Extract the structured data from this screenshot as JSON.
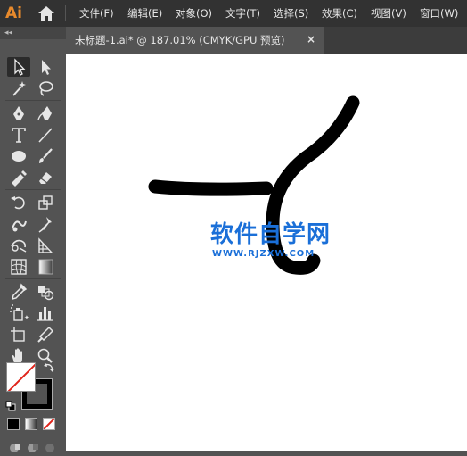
{
  "app": {
    "logo_text": "Ai"
  },
  "menu": {
    "items": [
      {
        "label": "文件(F)"
      },
      {
        "label": "编辑(E)"
      },
      {
        "label": "对象(O)"
      },
      {
        "label": "文字(T)"
      },
      {
        "label": "选择(S)"
      },
      {
        "label": "效果(C)"
      },
      {
        "label": "视图(V)"
      },
      {
        "label": "窗口(W)"
      }
    ]
  },
  "document_tab": {
    "title": "未标题-1.ai* @ 187.01% (CMYK/GPU 预览)",
    "close": "×"
  },
  "panel": {
    "collapse_glyph": "◂◂"
  },
  "watermark": {
    "title": "软件自学网",
    "url": "WWW.RJZXW.COM"
  },
  "colors": {
    "fill": "#ffffff",
    "stroke": "#000000",
    "none_slash": "#e0241b",
    "watermark": "#1a6fd8",
    "app_logo": "#e88a2c"
  }
}
